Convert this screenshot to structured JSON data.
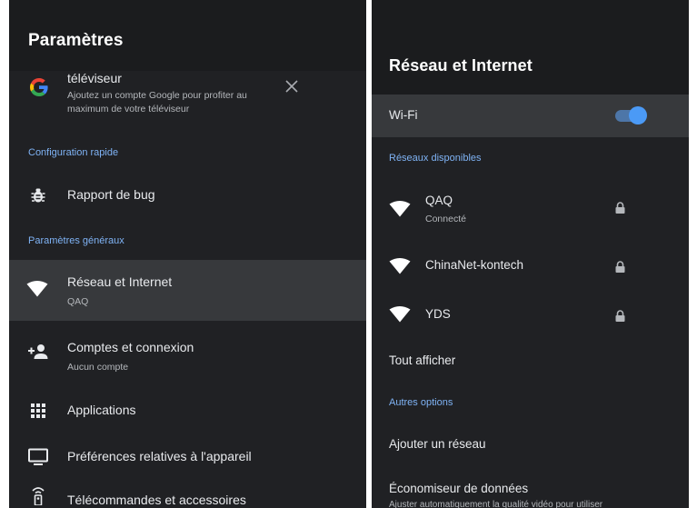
{
  "left": {
    "title": "Paramètres",
    "account_card": {
      "title": "téléviseur",
      "desc_line1": "Ajoutez un compte Google pour profiter au",
      "desc_line2": "maximum de votre téléviseur"
    },
    "sections": {
      "quick": "Configuration rapide",
      "general": "Paramètres généraux"
    },
    "items": [
      {
        "label": "Rapport de bug",
        "sub": ""
      },
      {
        "label": "Réseau et Internet",
        "sub": "QAQ"
      },
      {
        "label": "Comptes et connexion",
        "sub": "Aucun compte"
      },
      {
        "label": "Applications",
        "sub": ""
      },
      {
        "label": "Préférences relatives à l'appareil",
        "sub": ""
      },
      {
        "label": "Télécommandes et accessoires",
        "sub": ""
      }
    ],
    "icons": {
      "google": "google-logo-icon",
      "close": "close-icon",
      "bug": "bug-icon",
      "wifi": "wifi-icon",
      "add_account": "add-account-icon",
      "apps": "apps-grid-icon",
      "device": "tv-display-icon",
      "remote": "remote-icon"
    }
  },
  "right": {
    "title": "Réseau et Internet",
    "wifi": {
      "label": "Wi-Fi",
      "enabled": true
    },
    "sections": {
      "available": "Réseaux disponibles",
      "other": "Autres options"
    },
    "networks": [
      {
        "name": "QAQ",
        "status": "Connecté",
        "locked": true
      },
      {
        "name": "ChinaNet-kontech",
        "status": "",
        "locked": true
      },
      {
        "name": "YDS",
        "status": "",
        "locked": true
      }
    ],
    "show_all": "Tout afficher",
    "options": [
      {
        "label": "Ajouter un réseau",
        "sub": ""
      },
      {
        "label": "Économiseur de données",
        "sub": "Ajuster automatiquement la qualité vidéo pour utiliser"
      }
    ]
  },
  "colors": {
    "background": "#202124",
    "header": "#1b1c1e",
    "highlight": "#37393c",
    "section_text": "#7fb3f5",
    "toggle_on": "#4b9af6"
  }
}
